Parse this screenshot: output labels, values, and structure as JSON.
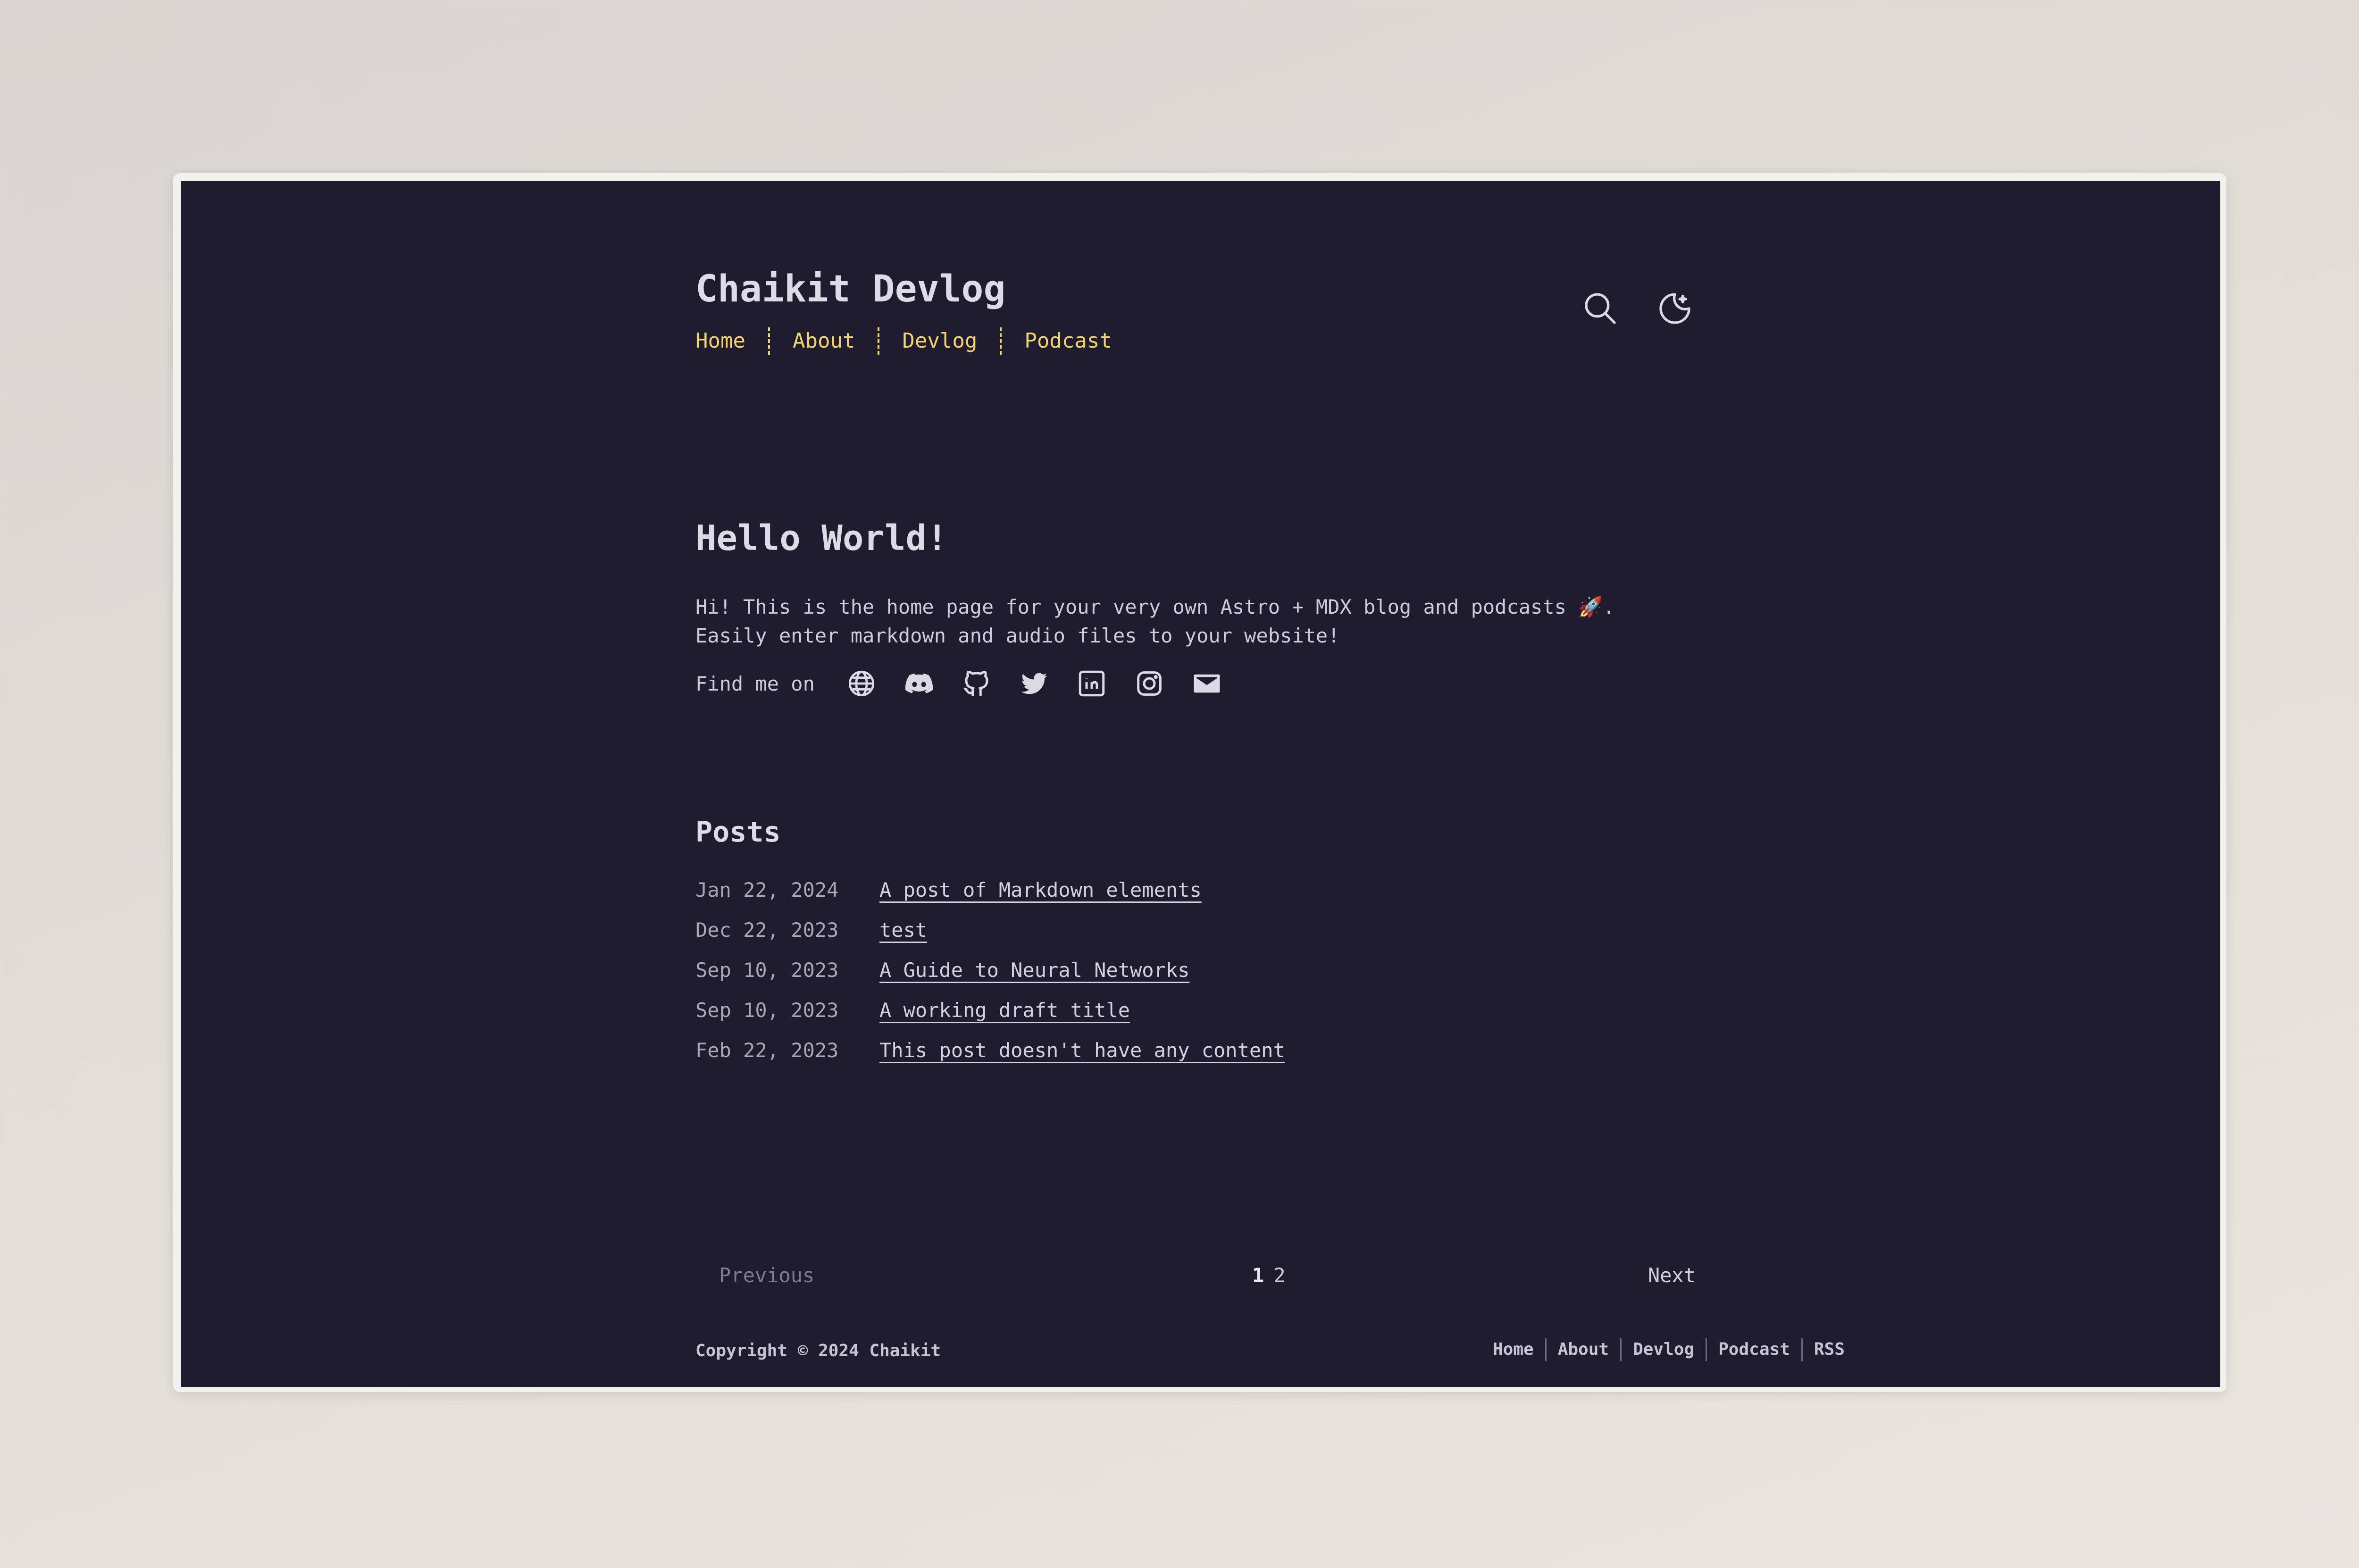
{
  "header": {
    "site_title": "Chaikit Devlog",
    "nav": [
      "Home",
      "About",
      "Devlog",
      "Podcast"
    ]
  },
  "icons": {
    "search": "search-icon",
    "theme": "moon-icon"
  },
  "hero": {
    "heading": "Hello World!",
    "intro_line_1": "Hi! This is the home page for your very own Astro + MDX blog and podcasts 🚀.",
    "intro_line_2": "Easily enter markdown and audio files to your website!",
    "find_me_label": "Find me on",
    "socials": [
      "globe-icon",
      "discord-icon",
      "github-icon",
      "twitter-icon",
      "linkedin-icon",
      "instagram-icon",
      "mail-icon"
    ]
  },
  "posts": {
    "title": "Posts",
    "items": [
      {
        "date": "Jan 22, 2024",
        "title": "A post of Markdown elements"
      },
      {
        "date": "Dec 22, 2023",
        "title": "test"
      },
      {
        "date": "Sep 10, 2023",
        "title": "A Guide to Neural Networks"
      },
      {
        "date": "Sep 10, 2023",
        "title": "A working draft title"
      },
      {
        "date": "Feb 22, 2023",
        "title": "This post doesn't have any content"
      }
    ]
  },
  "pagination": {
    "previous": "Previous",
    "pages": [
      "1",
      "2"
    ],
    "current": "1",
    "next": "Next"
  },
  "footer": {
    "copyright": "Copyright © 2024 Chaikit",
    "links": [
      "Home",
      "About",
      "Devlog",
      "Podcast",
      "RSS"
    ]
  },
  "colors": {
    "background": "#1f1c30",
    "accent": "#f2d46b",
    "text": "#d4d1de"
  }
}
